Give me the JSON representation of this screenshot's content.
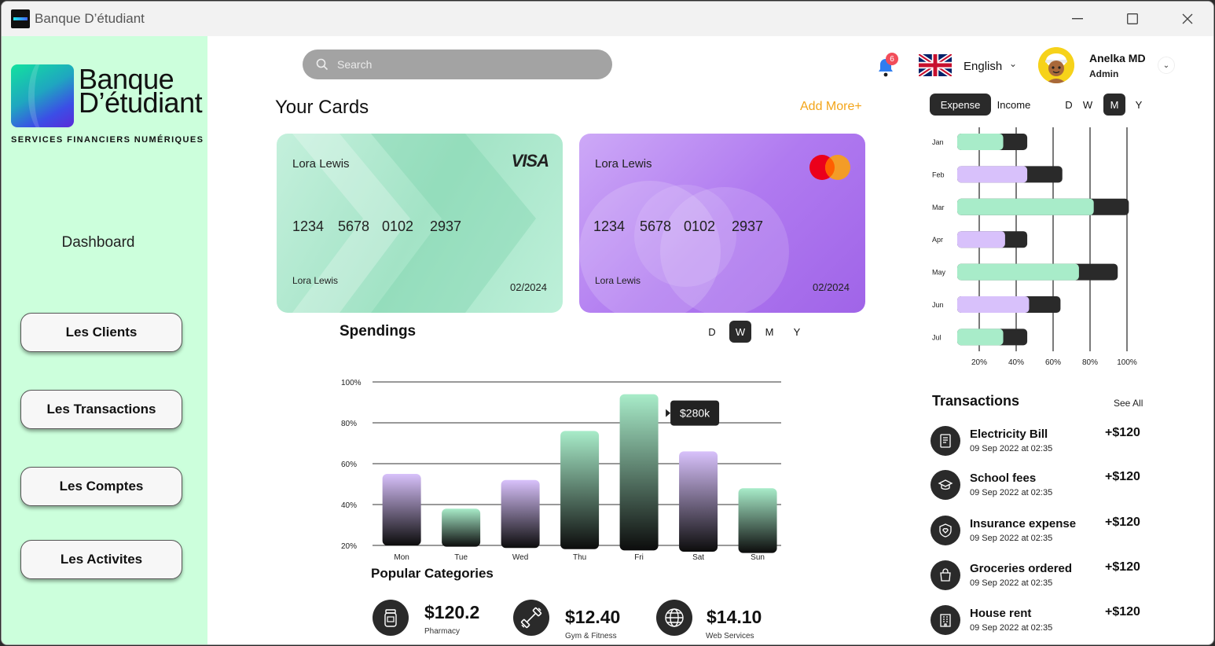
{
  "window": {
    "title": "Banque D’étudiant"
  },
  "brand": {
    "line1": "Banque",
    "line2": "D’étudiant",
    "tagline": "SERVICES FINANCIERS NUMÉRIQUES"
  },
  "sidebar": {
    "dashboard": "Dashboard",
    "items": [
      {
        "label": "Les Clients"
      },
      {
        "label": "Les Transactions"
      },
      {
        "label": "Les Comptes"
      },
      {
        "label": "Les Activites"
      }
    ]
  },
  "header": {
    "search_placeholder": "Search",
    "notification_count": "6",
    "language": "English",
    "user": {
      "name": "Anelka MD",
      "role": "Admin"
    }
  },
  "cards": {
    "title": "Your Cards",
    "add_more": "Add More+",
    "items": [
      {
        "holder": "Lora Lewis",
        "number": [
          "1234",
          "5678",
          "0102",
          "2937"
        ],
        "holder_bottom": "Lora Lewis",
        "expiry": "02/2024",
        "brand": "VISA"
      },
      {
        "holder": "Lora Lewis",
        "number": [
          "1234",
          "5678",
          "0102",
          "2937"
        ],
        "holder_bottom": "Lora Lewis",
        "expiry": "02/2024",
        "brand": "mastercard"
      }
    ]
  },
  "spendings": {
    "title": "Spendings",
    "periods": [
      "D",
      "W",
      "M",
      "Y"
    ],
    "active_period": "W"
  },
  "popular": {
    "title": "Popular Categories",
    "items": [
      {
        "value": "$120.2",
        "label": "Pharmacy",
        "icon": "pill-bottle-icon"
      },
      {
        "value": "$12.40",
        "label": "Gym & Fitness",
        "icon": "dumbbell-icon"
      },
      {
        "value": "$14.10",
        "label": "Web Services",
        "icon": "globe-icon"
      }
    ]
  },
  "expense_panel": {
    "tabs": [
      "Expense",
      "Income"
    ],
    "active_tab": "Expense",
    "periods": [
      "D",
      "W",
      "M",
      "Y"
    ],
    "active_period": "M"
  },
  "transactions": {
    "title": "Transactions",
    "see_all": "See All",
    "items": [
      {
        "name": "Electricity Bill",
        "date": "09 Sep 2022 at 02:35",
        "amount": "+$120",
        "icon": "receipt-icon"
      },
      {
        "name": "School fees",
        "date": "09 Sep 2022 at 02:35",
        "amount": "+$120",
        "icon": "graduation-cap-icon"
      },
      {
        "name": "Insurance expense",
        "date": "09 Sep 2022 at 02:35",
        "amount": "+$120",
        "icon": "shield-heart-icon"
      },
      {
        "name": "Groceries ordered",
        "date": "09 Sep 2022 at 02:35",
        "amount": "+$120",
        "icon": "shopping-bag-icon"
      },
      {
        "name": "House rent",
        "date": "09 Sep 2022 at 02:35",
        "amount": "+$120",
        "icon": "building-icon"
      }
    ]
  },
  "colors": {
    "mint": "#a8ecc9",
    "lavender": "#d8c1fb",
    "dark": "#2a2a2a",
    "accent": "#f3a51a",
    "sidebar": "#ccffdc"
  },
  "chart_data": [
    {
      "type": "bar",
      "title": "Spendings",
      "categories": [
        "Mon",
        "Tue",
        "Wed",
        "Thu",
        "Fri",
        "Sat",
        "Sun"
      ],
      "values": [
        55,
        38,
        52,
        76,
        94,
        66,
        48
      ],
      "y_ticks": [
        "20%",
        "40%",
        "60%",
        "80%",
        "100%"
      ],
      "ylim": [
        20,
        100
      ],
      "tooltip": {
        "category": "Fri",
        "label": "$280k"
      },
      "colors": [
        "lavender",
        "mint",
        "lavender",
        "mint",
        "mint",
        "lavender",
        "mint"
      ]
    },
    {
      "type": "bar",
      "orientation": "horizontal",
      "categories": [
        "Jan",
        "Feb",
        "Mar",
        "Apr",
        "May",
        "Jun",
        "Jul"
      ],
      "x_ticks": [
        "20%",
        "40%",
        "60%",
        "80%",
        "100%"
      ],
      "xlim": [
        20,
        100
      ],
      "series": [
        {
          "values": [
            33,
            46,
            82,
            34,
            74,
            47,
            33
          ]
        },
        {
          "values": [
            46,
            65,
            101,
            46,
            95,
            64,
            46
          ]
        }
      ],
      "colors": [
        "mint",
        "lavender",
        "mint",
        "lavender",
        "mint",
        "lavender",
        "mint"
      ]
    }
  ]
}
